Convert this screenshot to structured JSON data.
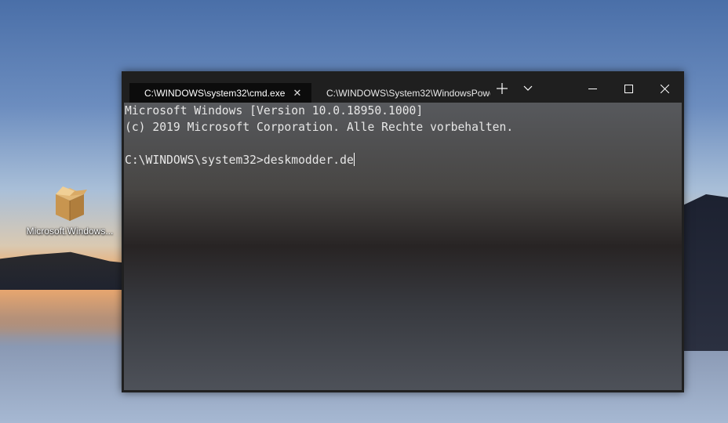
{
  "desktop": {
    "icons": [
      {
        "label": "Microsoft.Windows...",
        "icon": "package-box-icon"
      }
    ]
  },
  "terminal_window": {
    "tabs": [
      {
        "label": "C:\\WINDOWS\\system32\\cmd.exe",
        "active": true
      },
      {
        "label": "C:\\WINDOWS\\System32\\WindowsPowe",
        "active": false
      }
    ],
    "controls": {
      "new_tab": "+",
      "dropdown": "chevron-down-icon",
      "minimize": "minimize-icon",
      "maximize": "maximize-icon",
      "close": "close-icon"
    },
    "output": {
      "line1": "Microsoft Windows [Version 10.0.18950.1000]",
      "line2": "(c) 2019 Microsoft Corporation. Alle Rechte vorbehalten.",
      "line3": "",
      "prompt": "C:\\WINDOWS\\system32>",
      "command": "deskmodder.de"
    }
  }
}
